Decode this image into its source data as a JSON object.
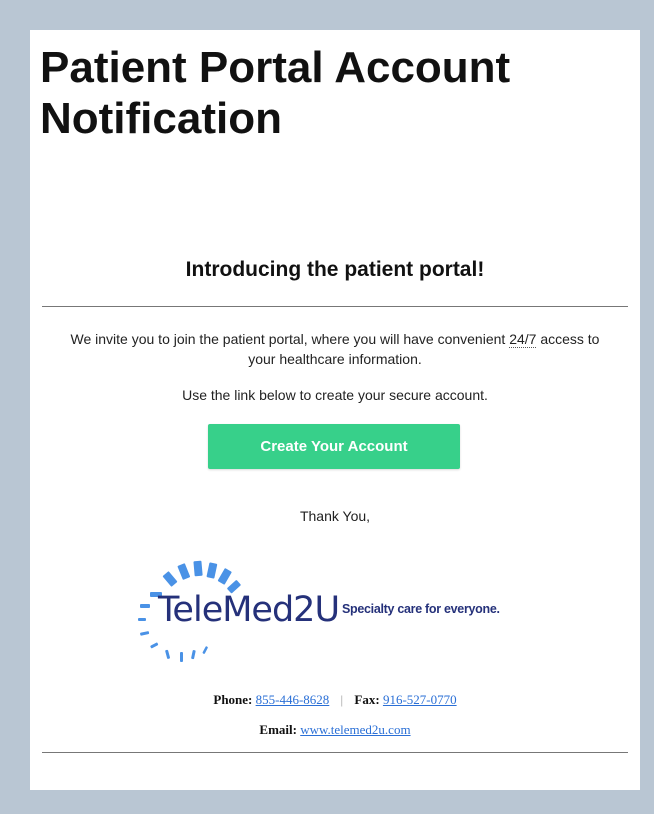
{
  "header": {
    "title": "Patient Portal Account Notification"
  },
  "intro": {
    "heading": "Introducing the patient portal!",
    "line1_pre": "We invite you to join the patient portal, where you will have convenient ",
    "line1_247": "24/7",
    "line1_post": " access to your healthcare information.",
    "line2": "Use the link below to create your secure account."
  },
  "cta": {
    "label": "Create Your Account",
    "color": "#37d08a"
  },
  "signoff": "Thank You,",
  "logo": {
    "wordmark_part1": "Tele",
    "wordmark_part2": "Med2U",
    "tagline": "Specialty care for everyone.",
    "brand_color": "#25317a",
    "accent_color": "#4a92e6"
  },
  "contact": {
    "phone_label": "Phone:",
    "phone": "855-446-8628",
    "separator": "|",
    "fax_label": "Fax:",
    "fax": "916-527-0770",
    "email_label": "Email:",
    "email": "www.telemed2u.com"
  }
}
